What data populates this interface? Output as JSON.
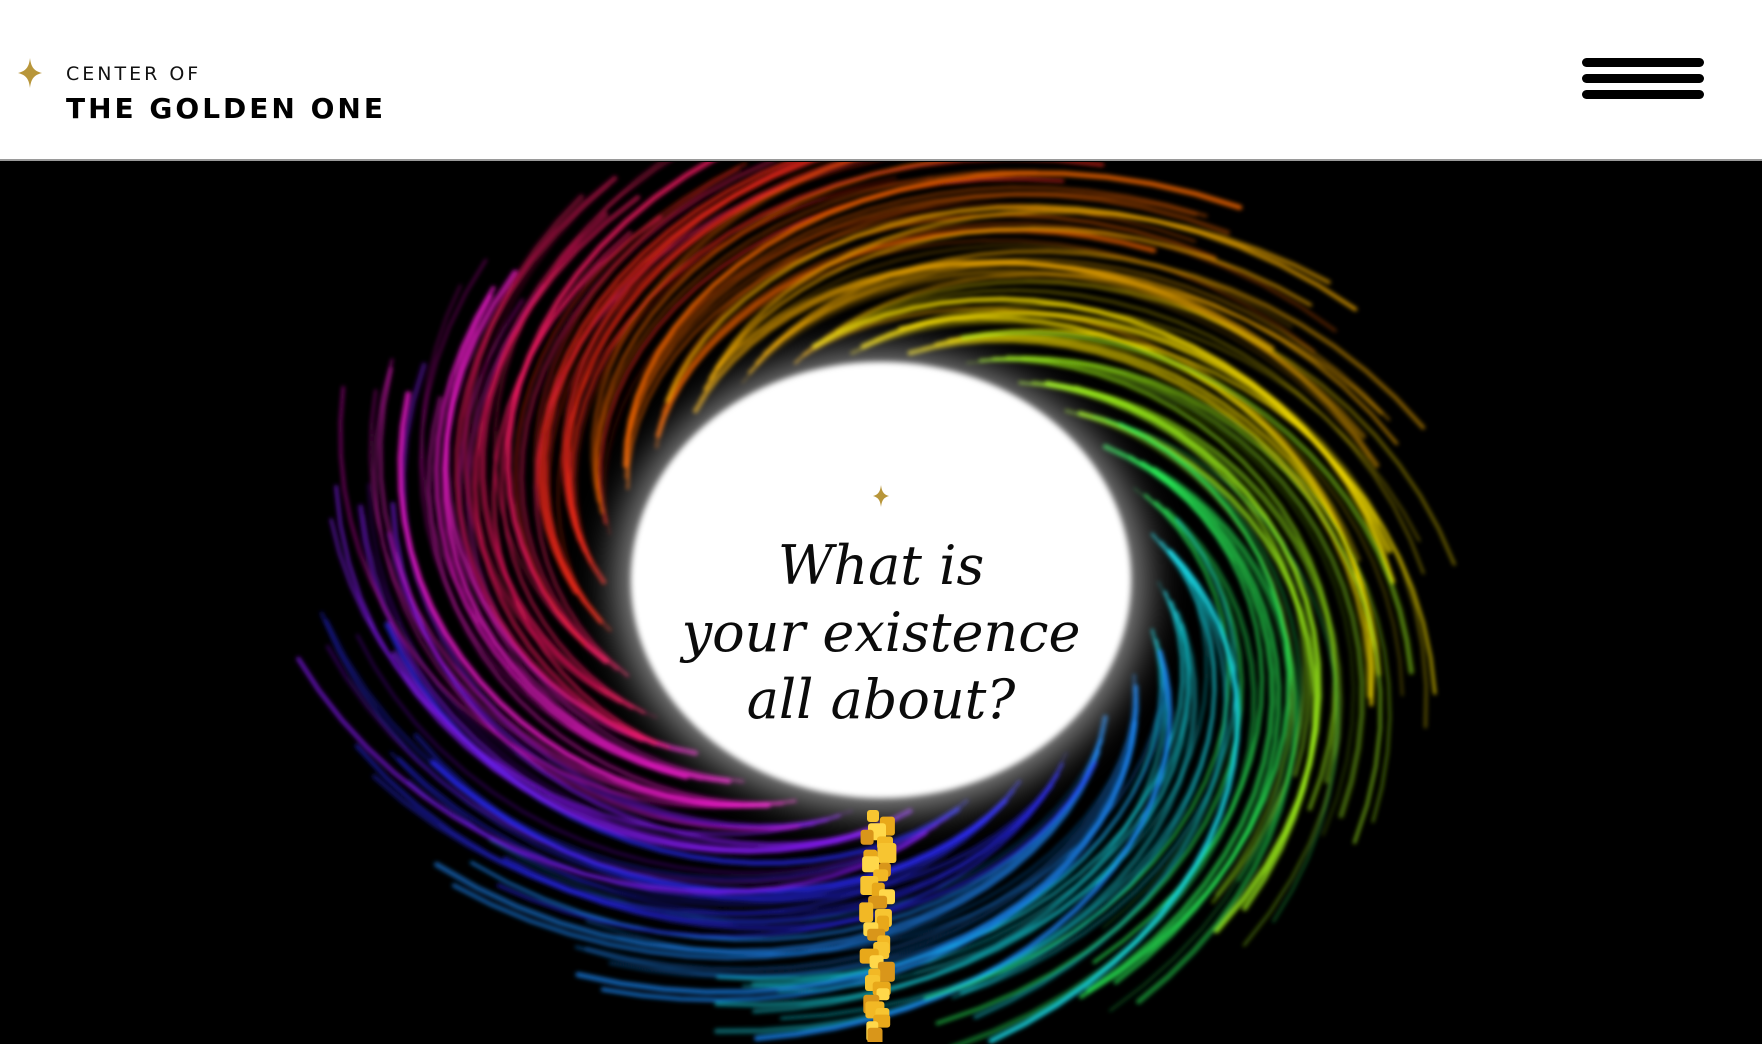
{
  "header": {
    "logo_line1": "CENTER OF",
    "logo_line2": "THE GOLDEN ONE",
    "logo_icon": "gold-star-icon",
    "menu_icon": "hamburger-menu-icon"
  },
  "hero": {
    "title_lines": [
      "What is",
      "your existence",
      "all about?"
    ],
    "ornament_icon": "gold-star-icon"
  },
  "colors": {
    "gold": "#B8963A",
    "header_bg": "#FFFFFF",
    "hero_bg": "#000000",
    "title_text": "#0B0B0B"
  }
}
